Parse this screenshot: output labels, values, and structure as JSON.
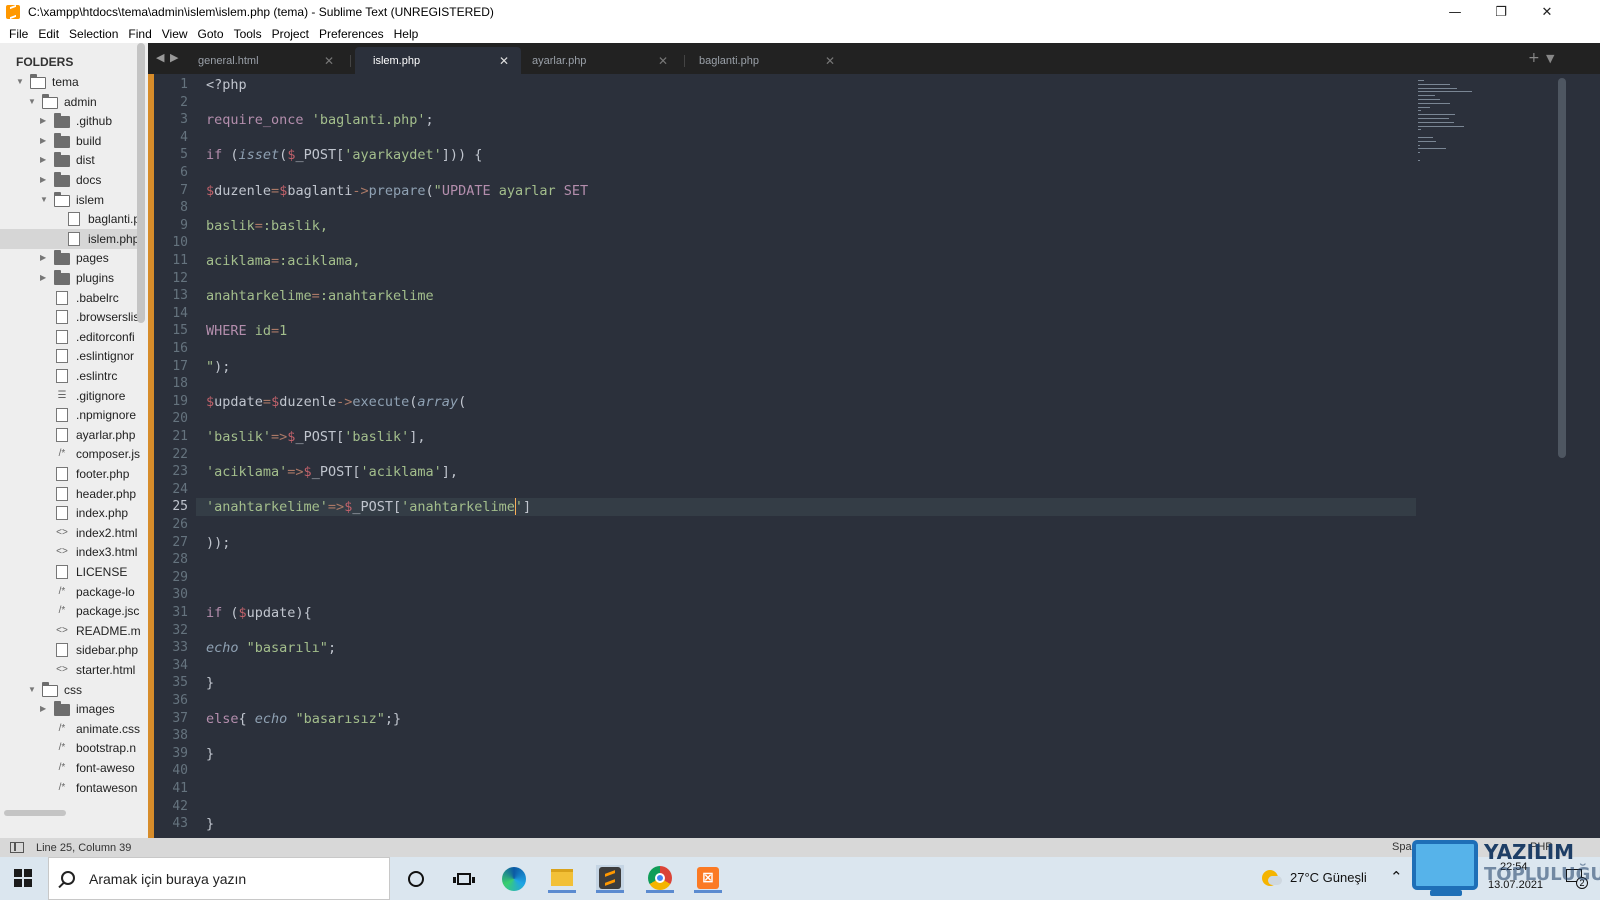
{
  "window": {
    "title": "C:\\xampp\\htdocs\\tema\\admin\\islem\\islem.php (tema) - Sublime Text (UNREGISTERED)",
    "minimize": "—",
    "restore": "❐",
    "close": "✕"
  },
  "menu": [
    "File",
    "Edit",
    "Selection",
    "Find",
    "View",
    "Goto",
    "Tools",
    "Project",
    "Preferences",
    "Help"
  ],
  "sidebar": {
    "title": "FOLDERS",
    "items": [
      {
        "label": "tema",
        "level": 0,
        "type": "folder-open",
        "expanded": true
      },
      {
        "label": "admin",
        "level": 1,
        "type": "folder-open",
        "expanded": true
      },
      {
        "label": ".github",
        "level": 2,
        "type": "folder",
        "expanded": false
      },
      {
        "label": "build",
        "level": 2,
        "type": "folder",
        "expanded": false
      },
      {
        "label": "dist",
        "level": 2,
        "type": "folder",
        "expanded": false
      },
      {
        "label": "docs",
        "level": 2,
        "type": "folder",
        "expanded": false
      },
      {
        "label": "islem",
        "level": 2,
        "type": "folder-open",
        "expanded": true
      },
      {
        "label": "baglanti.p",
        "level": 3,
        "type": "file"
      },
      {
        "label": "islem.php",
        "level": 3,
        "type": "file",
        "selected": true
      },
      {
        "label": "pages",
        "level": 2,
        "type": "folder",
        "expanded": false
      },
      {
        "label": "plugins",
        "level": 2,
        "type": "folder",
        "expanded": false
      },
      {
        "label": ".babelrc",
        "level": 2,
        "type": "file"
      },
      {
        "label": ".browserslis",
        "level": 2,
        "type": "file"
      },
      {
        "label": ".editorconfi",
        "level": 2,
        "type": "file"
      },
      {
        "label": ".eslintignor",
        "level": 2,
        "type": "file"
      },
      {
        "label": ".eslintrc",
        "level": 2,
        "type": "file"
      },
      {
        "label": ".gitignore",
        "level": 2,
        "type": "list"
      },
      {
        "label": ".npmignore",
        "level": 2,
        "type": "file"
      },
      {
        "label": "ayarlar.php",
        "level": 2,
        "type": "file"
      },
      {
        "label": "composer.js",
        "level": 2,
        "type": "comment"
      },
      {
        "label": "footer.php",
        "level": 2,
        "type": "file"
      },
      {
        "label": "header.php",
        "level": 2,
        "type": "file"
      },
      {
        "label": "index.php",
        "level": 2,
        "type": "file"
      },
      {
        "label": "index2.html",
        "level": 2,
        "type": "markup"
      },
      {
        "label": "index3.html",
        "level": 2,
        "type": "markup"
      },
      {
        "label": "LICENSE",
        "level": 2,
        "type": "file"
      },
      {
        "label": "package-lo",
        "level": 2,
        "type": "comment"
      },
      {
        "label": "package.jsc",
        "level": 2,
        "type": "comment"
      },
      {
        "label": "README.m",
        "level": 2,
        "type": "markup"
      },
      {
        "label": "sidebar.php",
        "level": 2,
        "type": "file"
      },
      {
        "label": "starter.html",
        "level": 2,
        "type": "markup"
      },
      {
        "label": "css",
        "level": 1,
        "type": "folder-open",
        "expanded": true
      },
      {
        "label": "images",
        "level": 2,
        "type": "folder",
        "expanded": false
      },
      {
        "label": "animate.css",
        "level": 2,
        "type": "comment"
      },
      {
        "label": "bootstrap.n",
        "level": 2,
        "type": "comment"
      },
      {
        "label": "font-aweso",
        "level": 2,
        "type": "comment"
      },
      {
        "label": "fontaweson",
        "level": 2,
        "type": "comment"
      }
    ]
  },
  "tabs": [
    {
      "label": "general.html",
      "active": false
    },
    {
      "label": "islem.php",
      "active": true
    },
    {
      "label": "ayarlar.php",
      "active": false
    },
    {
      "label": "baglanti.php",
      "active": false
    }
  ],
  "tab_nav": {
    "prev": "◀",
    "next": "▶",
    "new": "+",
    "menu": "▼",
    "close": "✕"
  },
  "editor": {
    "current_line": 25,
    "lines": [
      [
        [
          "plain",
          "<?php"
        ]
      ],
      [],
      [
        [
          "kw",
          "require_once"
        ],
        [
          "plain",
          " "
        ],
        [
          "str",
          "'baglanti.php'"
        ],
        [
          "plain",
          ";"
        ]
      ],
      [],
      [
        [
          "kw",
          "if"
        ],
        [
          "plain",
          " ("
        ],
        [
          "it",
          "isset"
        ],
        [
          "plain",
          "("
        ],
        [
          "var",
          "$"
        ],
        [
          "plain",
          "_POST["
        ],
        [
          "str",
          "'ayarkaydet'"
        ],
        [
          "plain",
          "])) {"
        ]
      ],
      [],
      [
        [
          "var",
          "$"
        ],
        [
          "plain",
          "duzenle"
        ],
        [
          "op",
          "="
        ],
        [
          "var",
          "$"
        ],
        [
          "plain",
          "baglanti"
        ],
        [
          "op",
          "->"
        ],
        [
          "fn",
          "prepare"
        ],
        [
          "plain",
          "("
        ],
        [
          "str",
          "\""
        ],
        [
          "kw",
          "UPDATE"
        ],
        [
          "str",
          " ayarlar "
        ],
        [
          "kw",
          "SET"
        ]
      ],
      [],
      [
        [
          "str",
          "baslik"
        ],
        [
          "op",
          "="
        ],
        [
          "str",
          ":baslik,"
        ]
      ],
      [],
      [
        [
          "str",
          "aciklama"
        ],
        [
          "op",
          "="
        ],
        [
          "str",
          ":aciklama,"
        ]
      ],
      [],
      [
        [
          "str",
          "anahtarkelime"
        ],
        [
          "op",
          "="
        ],
        [
          "str",
          ":anahtarkelime"
        ]
      ],
      [],
      [
        [
          "kw",
          "WHERE"
        ],
        [
          "str",
          " id"
        ],
        [
          "op",
          "="
        ],
        [
          "str",
          "1"
        ]
      ],
      [],
      [
        [
          "str",
          "\""
        ],
        [
          "plain",
          ");"
        ]
      ],
      [],
      [
        [
          "var",
          "$"
        ],
        [
          "plain",
          "update"
        ],
        [
          "op",
          "="
        ],
        [
          "var",
          "$"
        ],
        [
          "plain",
          "duzenle"
        ],
        [
          "op",
          "->"
        ],
        [
          "fn",
          "execute"
        ],
        [
          "plain",
          "("
        ],
        [
          "it",
          "array"
        ],
        [
          "plain",
          "("
        ]
      ],
      [],
      [
        [
          "str",
          "'baslik'"
        ],
        [
          "op",
          "=>"
        ],
        [
          "var",
          "$"
        ],
        [
          "plain",
          "_POST["
        ],
        [
          "str",
          "'baslik'"
        ],
        [
          "plain",
          "],"
        ]
      ],
      [],
      [
        [
          "str",
          "'aciklama'"
        ],
        [
          "op",
          "=>"
        ],
        [
          "var",
          "$"
        ],
        [
          "plain",
          "_POST["
        ],
        [
          "str",
          "'aciklama'"
        ],
        [
          "plain",
          "],"
        ]
      ],
      [],
      [
        [
          "str",
          "'anahtarkelime'"
        ],
        [
          "op",
          "=>"
        ],
        [
          "var",
          "$"
        ],
        [
          "plain",
          "_POST["
        ],
        [
          "str",
          "'anahtarkelime'"
        ],
        [
          "plain",
          "]"
        ]
      ],
      [],
      [
        [
          "plain",
          "));"
        ]
      ],
      [],
      [],
      [],
      [
        [
          "kw",
          "if"
        ],
        [
          "plain",
          " ("
        ],
        [
          "var",
          "$"
        ],
        [
          "plain",
          "update){"
        ]
      ],
      [],
      [
        [
          "it",
          "echo"
        ],
        [
          "plain",
          " "
        ],
        [
          "str",
          "\"basarılı\""
        ],
        [
          "plain",
          ";"
        ]
      ],
      [],
      [
        [
          "plain",
          "}"
        ]
      ],
      [],
      [
        [
          "kw",
          "else"
        ],
        [
          "plain",
          "{ "
        ],
        [
          "it",
          "echo"
        ],
        [
          "plain",
          " "
        ],
        [
          "str",
          "\"basarısız\""
        ],
        [
          "plain",
          ";}"
        ]
      ],
      [],
      [
        [
          "plain",
          "}"
        ]
      ],
      [],
      [],
      [],
      [
        [
          "plain",
          "}"
        ]
      ]
    ]
  },
  "status": {
    "position": "Line 25, Column 39",
    "spaces": "Spaces: 4",
    "syntax": "PHP"
  },
  "taskbar": {
    "search_placeholder": "Aramak için buraya yazın",
    "weather": "27°C  Güneşli",
    "time": "22:54",
    "date": "13.07.2021",
    "notifications": "2",
    "tray_arrow": "⌃"
  },
  "watermark": {
    "line1": "YAZILIM",
    "line2": "TOPLULUĞU"
  },
  "colors": {
    "editor_bg": "#2b303b",
    "keyword": "#b48ead",
    "string": "#a3be8c",
    "variable": "#bf616a",
    "function": "#8fa1b3",
    "gutter_accent": "#d78c2a",
    "caret": "#f9ae58"
  }
}
